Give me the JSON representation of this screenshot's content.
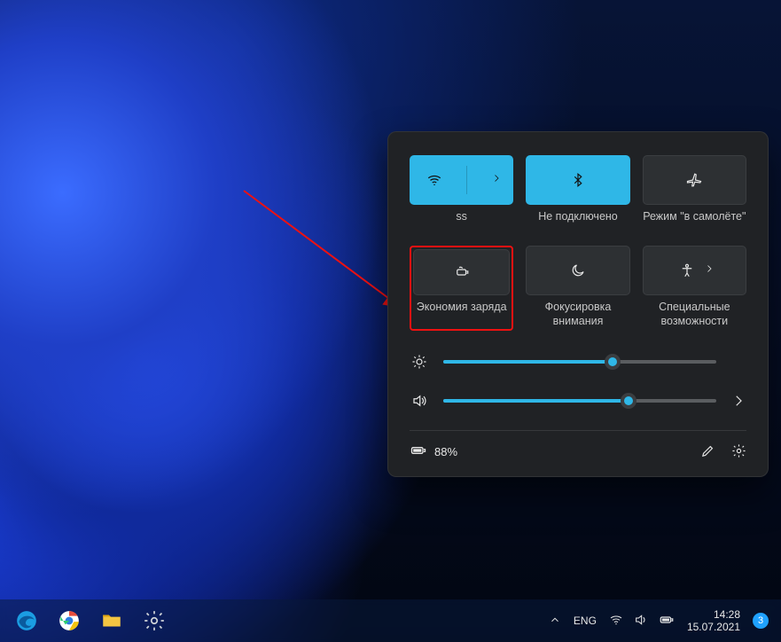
{
  "tiles": {
    "wifi": {
      "label": "ss",
      "active": true
    },
    "bluetooth": {
      "label": "Не подключено",
      "active": true
    },
    "airplane": {
      "label": "Режим \"в самолёте\"",
      "active": false
    },
    "battery": {
      "label": "Экономия заряда",
      "active": false
    },
    "focus": {
      "label": "Фокусировка внимания",
      "active": false
    },
    "access": {
      "label": "Специальные возможности",
      "active": false
    }
  },
  "sliders": {
    "brightness": {
      "percent": 62
    },
    "volume": {
      "percent": 68
    }
  },
  "footer": {
    "battery_text": "88%"
  },
  "taskbar": {
    "language": "ENG",
    "time": "14:28",
    "date": "15.07.2021",
    "notification_count": "3"
  },
  "annotation": {
    "highlighted_tile": "battery"
  }
}
